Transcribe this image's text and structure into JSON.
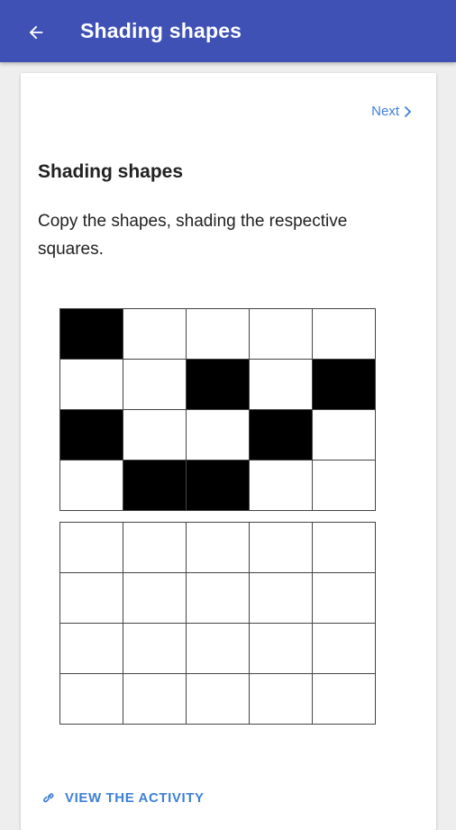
{
  "colors": {
    "primary": "#3f51b5",
    "accent": "#3f7fd6",
    "filled_cell": "#000000",
    "empty_cell": "#ffffff"
  },
  "app_bar": {
    "back_icon": "arrow-left-icon",
    "title": "Shading shapes"
  },
  "card": {
    "next_label": "Next",
    "next_icon": "chevron-right-icon",
    "title": "Shading shapes",
    "instructions": "Copy the shapes, shading the respective squares.",
    "pattern_grid": {
      "rows": 4,
      "cols": 5,
      "cells": [
        [
          1,
          0,
          0,
          0,
          0
        ],
        [
          0,
          0,
          1,
          0,
          1
        ],
        [
          1,
          0,
          0,
          1,
          0
        ],
        [
          0,
          1,
          1,
          0,
          0
        ]
      ]
    },
    "copy_grid": {
      "rows": 4,
      "cols": 5,
      "cells": [
        [
          0,
          0,
          0,
          0,
          0
        ],
        [
          0,
          0,
          0,
          0,
          0
        ],
        [
          0,
          0,
          0,
          0,
          0
        ],
        [
          0,
          0,
          0,
          0,
          0
        ]
      ]
    },
    "view_activity_label": "VIEW THE ACTIVITY",
    "view_activity_icon": "link-icon"
  }
}
